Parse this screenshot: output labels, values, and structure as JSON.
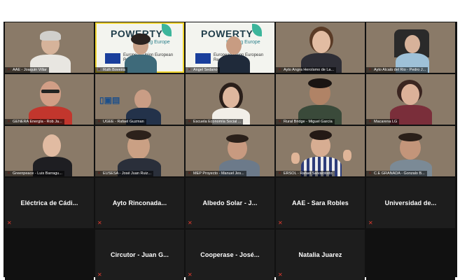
{
  "participants": [
    {
      "label": "AAE - Joaquin Villar",
      "type": "video"
    },
    {
      "label": "Ruth Boveira",
      "type": "poster",
      "poster": {
        "brand": "POWERTY",
        "brand_sub": "Interreg Europe",
        "eu_text": "European Union European Regional"
      }
    },
    {
      "label": "Angel Sedano",
      "type": "poster",
      "poster": {
        "brand": "POWERTY",
        "brand_sub": "Interreg Europe",
        "eu_text": "European Union European Regional"
      }
    },
    {
      "label": "Ayto Angra Heroísmo de La...",
      "type": "video"
    },
    {
      "label": "Ayto Alcalá del Rio - Pedro J...",
      "type": "video"
    },
    {
      "label": "GENERA Energía - Rob Ja...",
      "type": "video"
    },
    {
      "label": "UGEE - Rafael Guzman",
      "type": "video"
    },
    {
      "label": "Escuela Economía Social ...",
      "type": "video"
    },
    {
      "label": "Rural Bridge - Miguel García",
      "type": "video"
    },
    {
      "label": "Macarena LG",
      "type": "video"
    },
    {
      "label": "Greenpeace - Luis Barragu...",
      "type": "video"
    },
    {
      "label": "EUSESA - José Juan Ruiz...",
      "type": "video"
    },
    {
      "label": "MEP Proyecto - Manuel Jes...",
      "type": "video"
    },
    {
      "label": "ERSOL - Rafael Salvalotodo",
      "type": "video"
    },
    {
      "label": "C.E GRANADA - Gonzalo B...",
      "type": "video"
    },
    {
      "label": "Eléctrica de Cádi...",
      "type": "name"
    },
    {
      "label": "Ayto Rinconada...",
      "type": "name"
    },
    {
      "label": "Albedo Solar - J...",
      "type": "name"
    },
    {
      "label": "AAE - Sara Robles",
      "type": "name"
    },
    {
      "label": "Universidad de...",
      "type": "name"
    },
    {
      "label": "",
      "type": "blank"
    },
    {
      "label": "Circutor - Juan G...",
      "type": "name"
    },
    {
      "label": "Cooperase - José...",
      "type": "name"
    },
    {
      "label": "Natalia Juarez",
      "type": "name"
    },
    {
      "label": "",
      "type": "blank"
    }
  ],
  "colors": {
    "muted_mic": "#e23a2e",
    "active_speaker_outline": "#f1d52f",
    "tile_dark": "#1d1d1d"
  },
  "icons": {
    "muted": "mic-muted-icon"
  }
}
